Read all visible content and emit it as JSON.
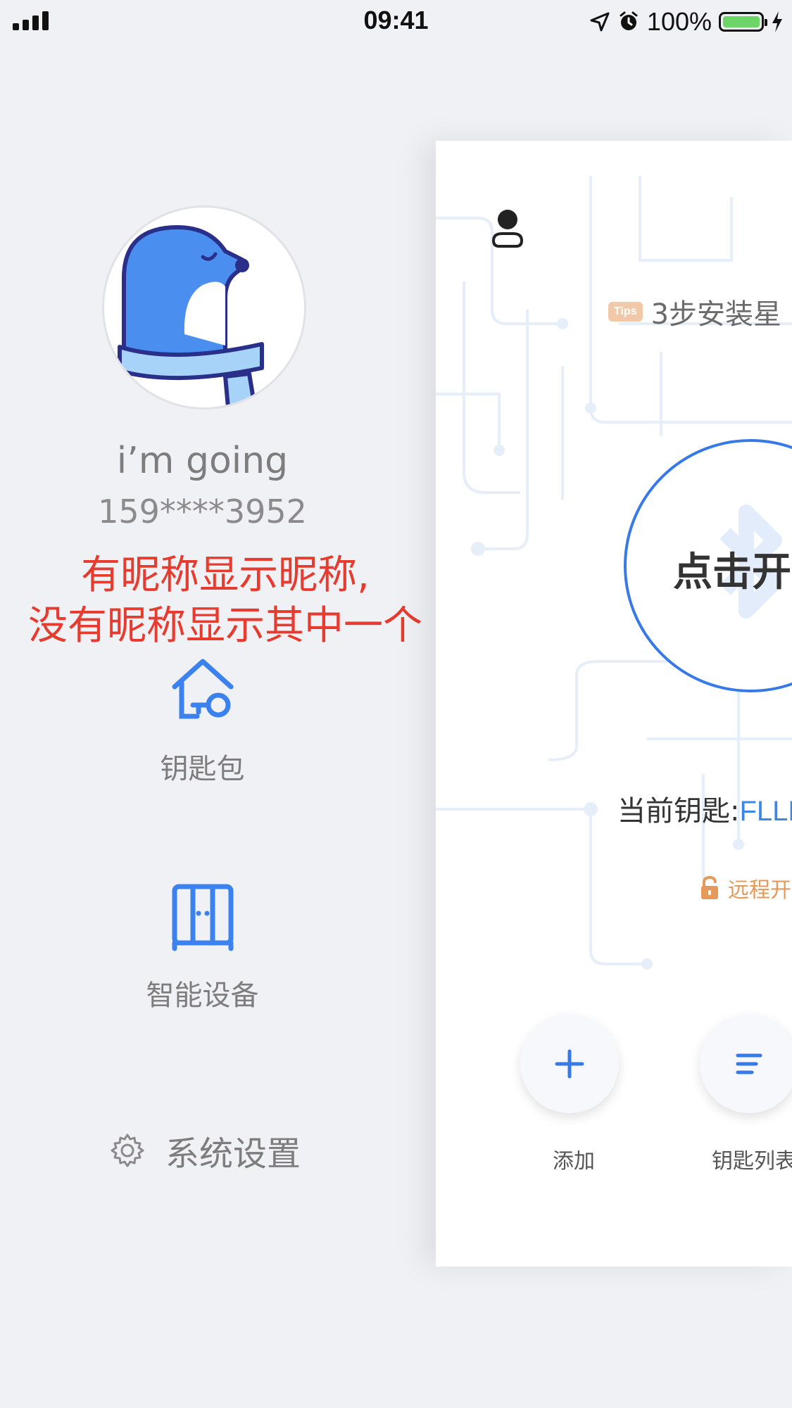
{
  "status_bar": {
    "time": "09:41",
    "battery": "100%"
  },
  "drawer": {
    "avatar": "mole-avatar",
    "nickname": "i’m going",
    "phone": "159****3952",
    "annotation_line1": "有昵称显示昵称,",
    "annotation_line2": "没有昵称显示其中一个",
    "items": [
      {
        "label": "钥匙包",
        "icon": "house-key-icon"
      },
      {
        "label": "智能设备",
        "icon": "cabinet-icon"
      }
    ],
    "settings_label": "系统设置"
  },
  "main": {
    "tips_badge": "Tips",
    "tips_text": "3步安装星",
    "unlock_text": "点击开",
    "current_key_label": "当前钥匙:",
    "current_key_value": "FLLL",
    "remote_open": "远程开",
    "add_label": "添加",
    "key_list_label": "钥匙列表"
  },
  "colors": {
    "accent": "#3779e6",
    "annotation": "#e63b2e",
    "remote": "#e59a5a",
    "background": "#f0f1f5"
  }
}
